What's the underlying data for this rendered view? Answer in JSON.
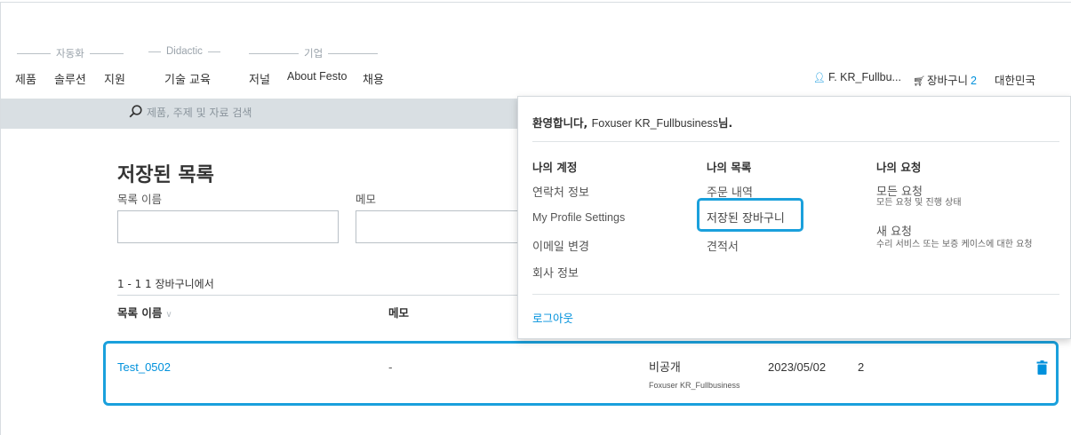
{
  "nav": {
    "groups": [
      "자동화",
      "Didactic",
      "기업"
    ],
    "items": [
      "제품",
      "솔루션",
      "지원",
      "기술 교육",
      "저널",
      "About Festo",
      "채용"
    ]
  },
  "account": {
    "user_label": "F. KR_Fullbu...",
    "cart_label": "장바구니",
    "cart_count": "2",
    "region": "대한민국"
  },
  "search": {
    "placeholder": "제품, 주제 및 자료 검색"
  },
  "page": {
    "title": "저장된 목록",
    "name_label": "목록 이름",
    "memo_label": "메모",
    "range_text": "1 - 1 1 장바구니에서",
    "columns": [
      "목록 이름",
      "메모"
    ],
    "row": {
      "name": "Test_0502",
      "memo": "-",
      "visibility": "비공개",
      "owner": "Foxuser KR_Fullbusiness",
      "date": "2023/05/02",
      "count": "2"
    }
  },
  "dropdown": {
    "welcome_prefix": "환영합니다,",
    "welcome_name": "Foxuser KR_Fullbusiness",
    "welcome_suffix": "님.",
    "col1": {
      "title": "나의 계정",
      "items": [
        "연락처 정보",
        "My Profile Settings",
        "이메일 변경",
        "회사 정보"
      ]
    },
    "col2": {
      "title": "나의 목록",
      "items": [
        "주문 내역",
        "저장된 장바구니",
        "견적서"
      ]
    },
    "col3": {
      "title": "나의 요청",
      "items": [
        {
          "label": "모든 요청",
          "desc": "모든 요청 및 진행 상태"
        },
        {
          "label": "새 요청",
          "desc": "수리 서비스 또는 보증 케이스에 대한 요청"
        }
      ]
    },
    "logout": "로그아웃"
  },
  "colors": {
    "accent": "#0091dc",
    "highlight": "#1aa0dc",
    "search_band": "#d9dfe3"
  },
  "icons": [
    "user-icon",
    "cart-icon",
    "search-icon",
    "trash-icon"
  ]
}
